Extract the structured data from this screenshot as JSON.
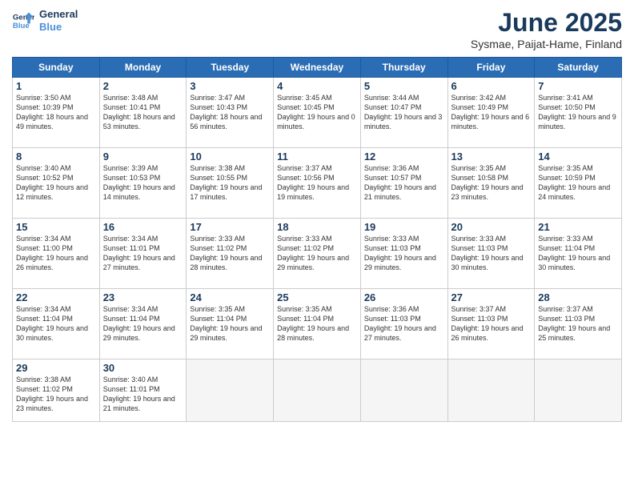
{
  "logo": {
    "line1": "General",
    "line2": "Blue"
  },
  "title": "June 2025",
  "subtitle": "Sysmae, Paijat-Hame, Finland",
  "headers": [
    "Sunday",
    "Monday",
    "Tuesday",
    "Wednesday",
    "Thursday",
    "Friday",
    "Saturday"
  ],
  "weeks": [
    [
      {
        "num": "1",
        "info": "Sunrise: 3:50 AM\nSunset: 10:39 PM\nDaylight: 18 hours\nand 49 minutes."
      },
      {
        "num": "2",
        "info": "Sunrise: 3:48 AM\nSunset: 10:41 PM\nDaylight: 18 hours\nand 53 minutes."
      },
      {
        "num": "3",
        "info": "Sunrise: 3:47 AM\nSunset: 10:43 PM\nDaylight: 18 hours\nand 56 minutes."
      },
      {
        "num": "4",
        "info": "Sunrise: 3:45 AM\nSunset: 10:45 PM\nDaylight: 19 hours\nand 0 minutes."
      },
      {
        "num": "5",
        "info": "Sunrise: 3:44 AM\nSunset: 10:47 PM\nDaylight: 19 hours\nand 3 minutes."
      },
      {
        "num": "6",
        "info": "Sunrise: 3:42 AM\nSunset: 10:49 PM\nDaylight: 19 hours\nand 6 minutes."
      },
      {
        "num": "7",
        "info": "Sunrise: 3:41 AM\nSunset: 10:50 PM\nDaylight: 19 hours\nand 9 minutes."
      }
    ],
    [
      {
        "num": "8",
        "info": "Sunrise: 3:40 AM\nSunset: 10:52 PM\nDaylight: 19 hours\nand 12 minutes."
      },
      {
        "num": "9",
        "info": "Sunrise: 3:39 AM\nSunset: 10:53 PM\nDaylight: 19 hours\nand 14 minutes."
      },
      {
        "num": "10",
        "info": "Sunrise: 3:38 AM\nSunset: 10:55 PM\nDaylight: 19 hours\nand 17 minutes."
      },
      {
        "num": "11",
        "info": "Sunrise: 3:37 AM\nSunset: 10:56 PM\nDaylight: 19 hours\nand 19 minutes."
      },
      {
        "num": "12",
        "info": "Sunrise: 3:36 AM\nSunset: 10:57 PM\nDaylight: 19 hours\nand 21 minutes."
      },
      {
        "num": "13",
        "info": "Sunrise: 3:35 AM\nSunset: 10:58 PM\nDaylight: 19 hours\nand 23 minutes."
      },
      {
        "num": "14",
        "info": "Sunrise: 3:35 AM\nSunset: 10:59 PM\nDaylight: 19 hours\nand 24 minutes."
      }
    ],
    [
      {
        "num": "15",
        "info": "Sunrise: 3:34 AM\nSunset: 11:00 PM\nDaylight: 19 hours\nand 26 minutes."
      },
      {
        "num": "16",
        "info": "Sunrise: 3:34 AM\nSunset: 11:01 PM\nDaylight: 19 hours\nand 27 minutes."
      },
      {
        "num": "17",
        "info": "Sunrise: 3:33 AM\nSunset: 11:02 PM\nDaylight: 19 hours\nand 28 minutes."
      },
      {
        "num": "18",
        "info": "Sunrise: 3:33 AM\nSunset: 11:02 PM\nDaylight: 19 hours\nand 29 minutes."
      },
      {
        "num": "19",
        "info": "Sunrise: 3:33 AM\nSunset: 11:03 PM\nDaylight: 19 hours\nand 29 minutes."
      },
      {
        "num": "20",
        "info": "Sunrise: 3:33 AM\nSunset: 11:03 PM\nDaylight: 19 hours\nand 30 minutes."
      },
      {
        "num": "21",
        "info": "Sunrise: 3:33 AM\nSunset: 11:04 PM\nDaylight: 19 hours\nand 30 minutes."
      }
    ],
    [
      {
        "num": "22",
        "info": "Sunrise: 3:34 AM\nSunset: 11:04 PM\nDaylight: 19 hours\nand 30 minutes."
      },
      {
        "num": "23",
        "info": "Sunrise: 3:34 AM\nSunset: 11:04 PM\nDaylight: 19 hours\nand 29 minutes."
      },
      {
        "num": "24",
        "info": "Sunrise: 3:35 AM\nSunset: 11:04 PM\nDaylight: 19 hours\nand 29 minutes."
      },
      {
        "num": "25",
        "info": "Sunrise: 3:35 AM\nSunset: 11:04 PM\nDaylight: 19 hours\nand 28 minutes."
      },
      {
        "num": "26",
        "info": "Sunrise: 3:36 AM\nSunset: 11:03 PM\nDaylight: 19 hours\nand 27 minutes."
      },
      {
        "num": "27",
        "info": "Sunrise: 3:37 AM\nSunset: 11:03 PM\nDaylight: 19 hours\nand 26 minutes."
      },
      {
        "num": "28",
        "info": "Sunrise: 3:37 AM\nSunset: 11:03 PM\nDaylight: 19 hours\nand 25 minutes."
      }
    ],
    [
      {
        "num": "29",
        "info": "Sunrise: 3:38 AM\nSunset: 11:02 PM\nDaylight: 19 hours\nand 23 minutes."
      },
      {
        "num": "30",
        "info": "Sunrise: 3:40 AM\nSunset: 11:01 PM\nDaylight: 19 hours\nand 21 minutes."
      },
      null,
      null,
      null,
      null,
      null
    ]
  ]
}
